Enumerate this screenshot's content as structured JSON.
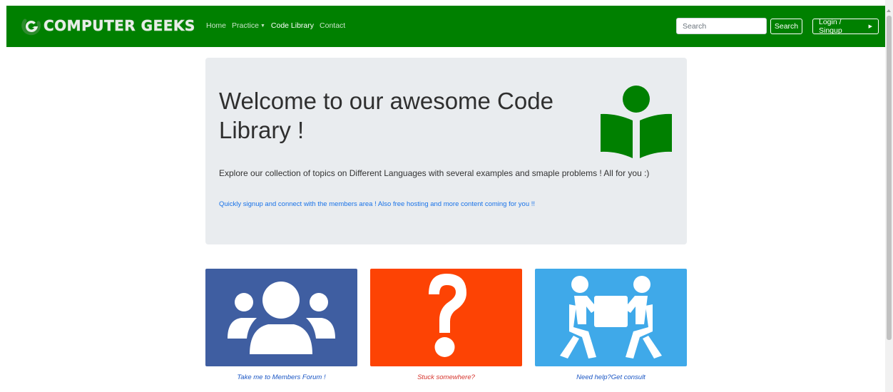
{
  "navbar": {
    "brand": "COMPUTER GEEKS",
    "links": [
      {
        "label": "Home",
        "dropdown": false,
        "active": false
      },
      {
        "label": "Practice",
        "dropdown": true,
        "active": false
      },
      {
        "label": "Code Library",
        "dropdown": false,
        "active": true
      },
      {
        "label": "Contact",
        "dropdown": false,
        "active": false
      }
    ],
    "search_placeholder": "Search",
    "search_button": "Search",
    "login_button": "Login / Singup",
    "bg_color": "#008000"
  },
  "jumbotron": {
    "title": "Welcome to our awesome Code Library !",
    "lead": "Explore our collection of topics on Different Languages with several examples and smaple problems ! All for you :)",
    "link_text": "Quickly signup and connect with the members area ! Also free hosting and more content coming for you !!",
    "icon": "reader-book-icon"
  },
  "cards": [
    {
      "icon": "users-group-icon",
      "caption": "Take me to Members Forum !",
      "bg_color": "#3f5ea1"
    },
    {
      "icon": "question-mark-icon",
      "caption": "Stuck somewhere?",
      "bg_color": "#fd4304"
    },
    {
      "icon": "people-carrying-box-icon",
      "caption": "Need help?Get consult",
      "bg_color": "#3fa9e9"
    }
  ]
}
